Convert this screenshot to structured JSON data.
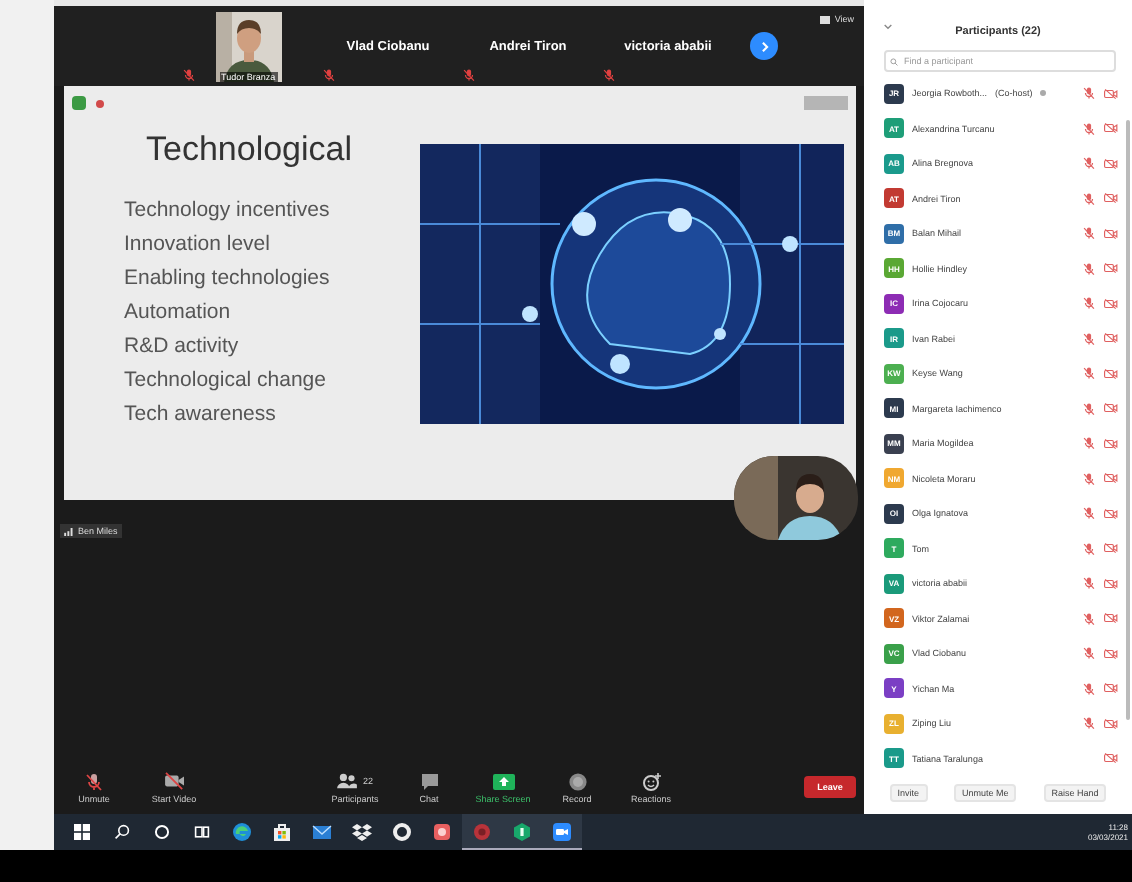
{
  "gallery": {
    "tiles": [
      {
        "name": "Tudor Branza",
        "kind": "video",
        "muted": true
      },
      {
        "name": "Vlad Ciobanu",
        "kind": "name",
        "muted": true
      },
      {
        "name": "Andrei Tiron",
        "kind": "name",
        "muted": true
      },
      {
        "name": "victoria ababii",
        "kind": "name",
        "muted": true
      }
    ],
    "view_label": "View"
  },
  "share": {
    "slide": {
      "title": "Technological",
      "bullets": [
        "Technology incentives",
        "Innovation level",
        "Enabling technologies",
        "Automation",
        "R&D activity",
        "Technological change",
        "Tech awareness"
      ]
    }
  },
  "speaker": {
    "name": "Ben Miles"
  },
  "toolbar": {
    "items": [
      {
        "label": "Unmute",
        "kind": "mic"
      },
      {
        "label": "Start Video",
        "kind": "video"
      },
      {
        "label": "Participants",
        "kind": "participants",
        "count": "22"
      },
      {
        "label": "Chat",
        "kind": "chat"
      },
      {
        "label": "Share Screen",
        "kind": "share"
      },
      {
        "label": "Record",
        "kind": "record"
      },
      {
        "label": "Reactions",
        "kind": "reactions"
      }
    ],
    "leave": "Leave"
  },
  "participants": {
    "title": "Participants (22)",
    "placeholder": "Find a participant",
    "items": [
      {
        "initials": "JR",
        "name": "Jeorgia Rowboth...",
        "role": "(Co-host)",
        "color": "#2c3a4e",
        "muted": true,
        "video_off": true
      },
      {
        "initials": "AT",
        "name": "Alexandrina Turcanu",
        "color": "#1e9e78",
        "muted": true,
        "video_off": true
      },
      {
        "initials": "AB",
        "name": "Alina Bregnova",
        "color": "#1a9a8c",
        "muted": true,
        "video_off": true
      },
      {
        "initials": "AT",
        "name": "Andrei Tiron",
        "color": "#c23a32",
        "muted": true,
        "video_off": true
      },
      {
        "initials": "BM",
        "name": "Balan Mihail",
        "color": "#2f6ea8",
        "muted": true,
        "video_off": true
      },
      {
        "initials": "HH",
        "name": "Hollie Hindley",
        "color": "#5aa834",
        "muted": true,
        "video_off": true
      },
      {
        "initials": "IC",
        "name": "Irina Cojocaru",
        "color": "#8d2cb4",
        "muted": true,
        "video_off": true
      },
      {
        "initials": "IR",
        "name": "Ivan Rabei",
        "color": "#1b9a8a",
        "muted": true,
        "video_off": true
      },
      {
        "initials": "KW",
        "name": "Keyse Wang",
        "color": "#4caf50",
        "muted": true,
        "video_off": true
      },
      {
        "initials": "MI",
        "name": "Margareta Iachimenco",
        "color": "#2c3a4e",
        "muted": true,
        "video_off": true
      },
      {
        "initials": "MM",
        "name": "Maria Mogildea",
        "color": "#3a4050",
        "muted": true,
        "video_off": true
      },
      {
        "initials": "NM",
        "name": "Nicoleta Moraru",
        "color": "#f0a830",
        "muted": true,
        "video_off": true
      },
      {
        "initials": "OI",
        "name": "Olga Ignatova",
        "color": "#2c3a4e",
        "muted": true,
        "video_off": true
      },
      {
        "initials": "T",
        "name": "Tom",
        "color": "#2eaa5e",
        "muted": true,
        "video_off": true
      },
      {
        "initials": "VA",
        "name": "victoria ababii",
        "color": "#1a9a7a",
        "muted": true,
        "video_off": true
      },
      {
        "initials": "VZ",
        "name": "Viktor Zalamai",
        "color": "#d2661e",
        "muted": true,
        "video_off": true
      },
      {
        "initials": "VC",
        "name": "Vlad Ciobanu",
        "color": "#3aa04a",
        "muted": true,
        "video_off": true
      },
      {
        "initials": "Y",
        "name": "Yichan Ma",
        "color": "#7b3fc4",
        "muted": true,
        "video_off": true
      },
      {
        "initials": "ZL",
        "name": "Ziping Liu",
        "color": "#e8b030",
        "muted": true,
        "video_off": true
      },
      {
        "initials": "TT",
        "name": "Tatiana Taralunga",
        "color": "#1a9a8a",
        "muted": false,
        "video_off": true
      }
    ],
    "buttons": [
      "Invite",
      "Unmute Me",
      "Raise Hand"
    ]
  },
  "taskbar": {
    "apps": [
      {
        "kind": "edge",
        "open": false
      },
      {
        "kind": "store",
        "open": false
      },
      {
        "kind": "mail",
        "open": false
      },
      {
        "kind": "dropbox",
        "open": false
      },
      {
        "kind": "lifebuoy",
        "open": false
      },
      {
        "kind": "redapp",
        "open": false
      },
      {
        "kind": "redapp2",
        "open": true
      },
      {
        "kind": "greenapp",
        "open": true
      },
      {
        "kind": "zoom",
        "open": true
      }
    ],
    "time": "11:28",
    "date": "03/03/2021"
  }
}
